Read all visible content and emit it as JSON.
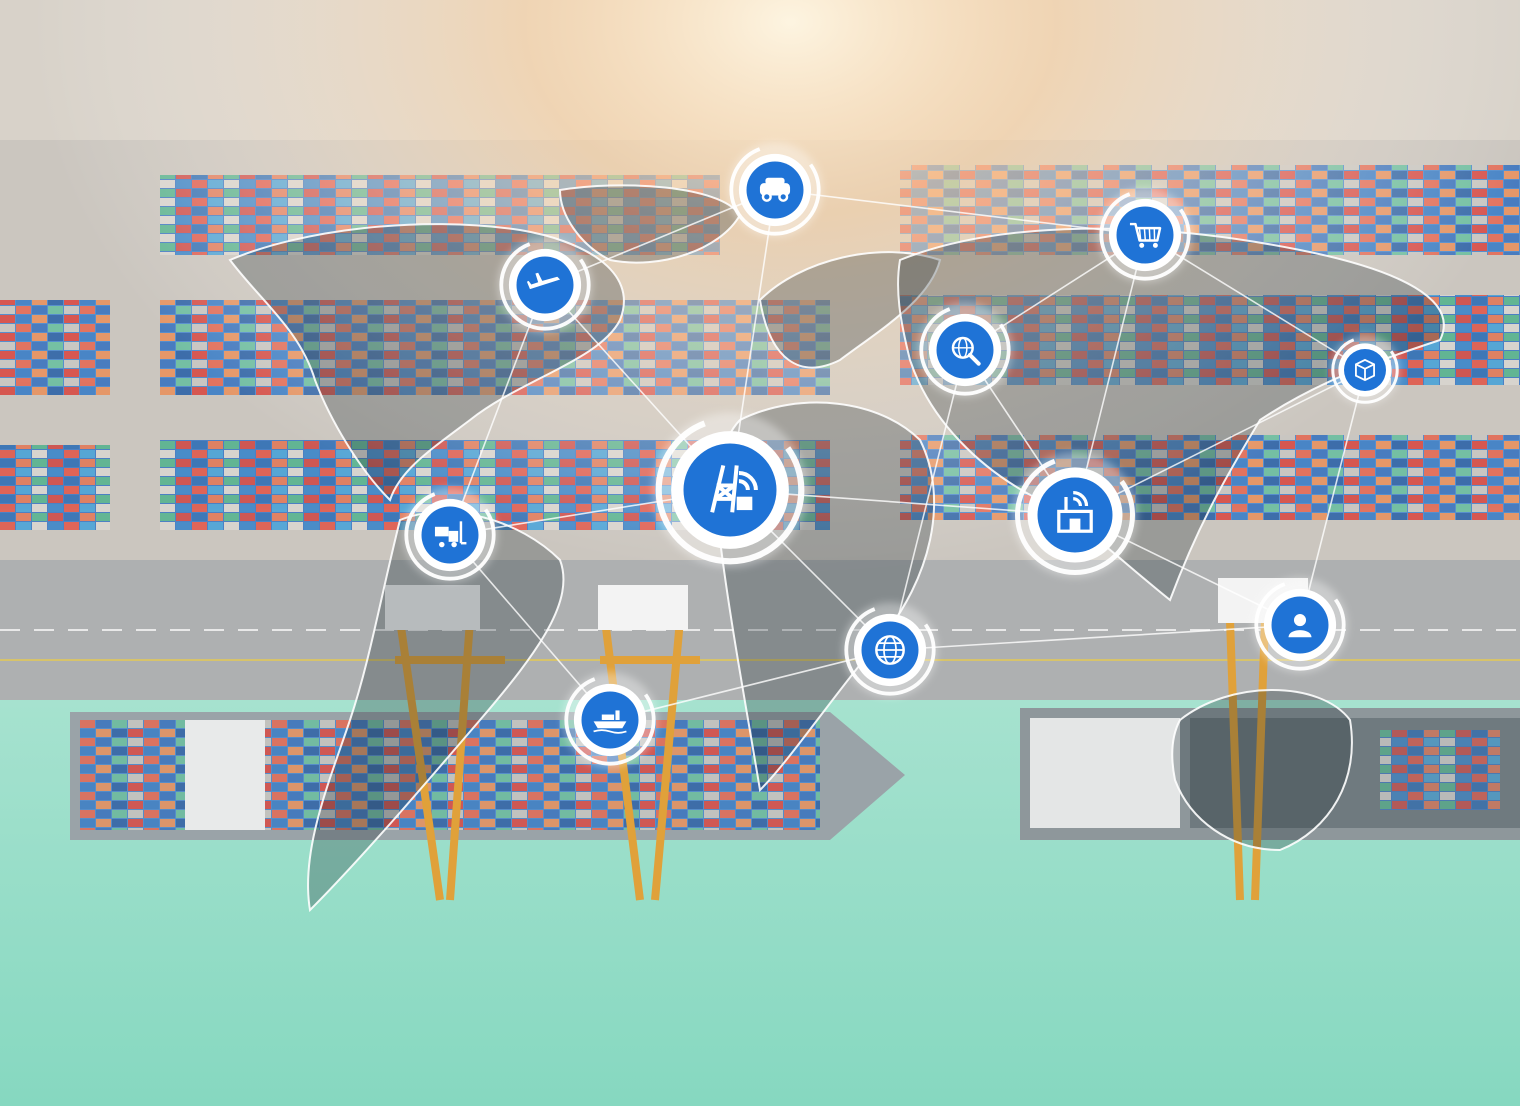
{
  "image": {
    "subject": "logistics-network-over-container-port",
    "colors": {
      "water": "#8fdcc4",
      "dock": "#c9c4bd",
      "sunlight": "#ffd9a8",
      "icon_blue": "#1f73d6",
      "link_line": "#ffffff"
    }
  },
  "nodes": [
    {
      "id": "truck",
      "icon": "truck-icon"
    },
    {
      "id": "airplane",
      "icon": "airplane-icon"
    },
    {
      "id": "shopping-cart",
      "icon": "shopping-cart-icon"
    },
    {
      "id": "global-search",
      "icon": "globe-search-icon"
    },
    {
      "id": "package",
      "icon": "package-icon"
    },
    {
      "id": "radio-tower",
      "icon": "radio-tower-icon"
    },
    {
      "id": "warehouse-wireless",
      "icon": "warehouse-wireless-icon"
    },
    {
      "id": "forklift",
      "icon": "forklift-icon"
    },
    {
      "id": "globe",
      "icon": "globe-icon"
    },
    {
      "id": "user",
      "icon": "user-icon"
    },
    {
      "id": "cargo-ship",
      "icon": "cargo-ship-icon"
    }
  ]
}
